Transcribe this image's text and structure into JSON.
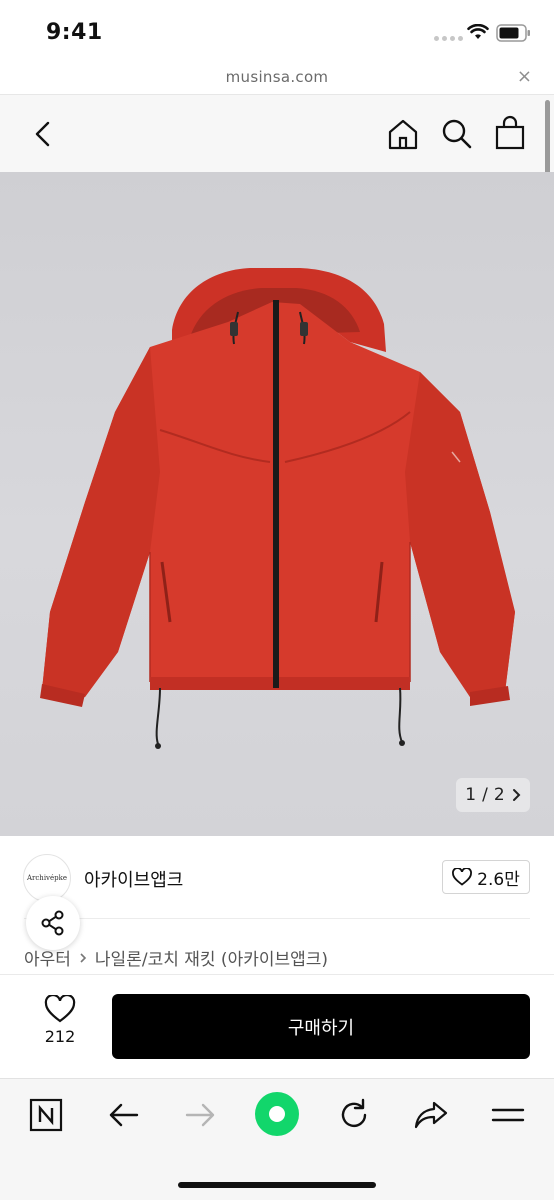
{
  "status_bar": {
    "time": "9:41"
  },
  "browser": {
    "url": "musinsa.com",
    "close_label": "×"
  },
  "gallery": {
    "current": "1",
    "separator": "/",
    "total": "2",
    "product_color": "#d63a2c",
    "background": "#d5d5d9"
  },
  "brand": {
    "logo_text": "Archivépke",
    "name": "아카이브앱크",
    "likes": "2.6만"
  },
  "breadcrumb": {
    "category": "아우터",
    "product": "나일론/코치 재킷 (아카이브앱크)"
  },
  "purchase": {
    "wish_count": "212",
    "buy_label": "구매하기"
  },
  "colors": {
    "brand_green": "#12d66b",
    "buy_button": "#000000"
  },
  "toolbar_icons": [
    "naver-n-icon",
    "back-arrow-icon",
    "forward-arrow-icon",
    "green-dot-icon",
    "refresh-icon",
    "share-arrow-icon",
    "menu-icon"
  ]
}
